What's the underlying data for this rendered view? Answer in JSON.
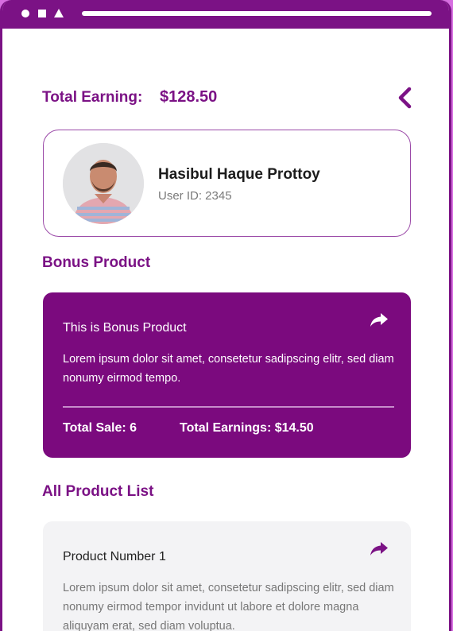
{
  "header": {
    "earning_label": "Total Earning:",
    "earning_value": "$128.50",
    "back_icon": "chevron-left-icon"
  },
  "profile": {
    "name": "Hasibul Haque Prottoy",
    "user_id": "User ID: 2345"
  },
  "bonus_section": {
    "title": "Bonus Product",
    "card": {
      "title": "This is Bonus Product",
      "description": "Lorem ipsum dolor sit amet, consetetur sadipscing elitr, sed diam nonumy eirmod tempo.",
      "total_sale": "Total Sale: 6",
      "total_earnings": "Total Earnings: $14.50",
      "share_icon": "share-icon"
    }
  },
  "product_section": {
    "title": "All Product List",
    "items": [
      {
        "title": "Product Number 1",
        "description": "Lorem ipsum dolor sit amet, consetetur sadipscing elitr, sed diam nonumy eirmod tempor invidunt ut labore et dolore magna aliquyam erat, sed diam voluptua.",
        "share_icon": "share-icon"
      }
    ]
  },
  "colors": {
    "primary": "#7b1285",
    "card_purple": "#7b0a7e",
    "background_pink": "#d66ee0",
    "card_grey": "#f3f3f5"
  }
}
